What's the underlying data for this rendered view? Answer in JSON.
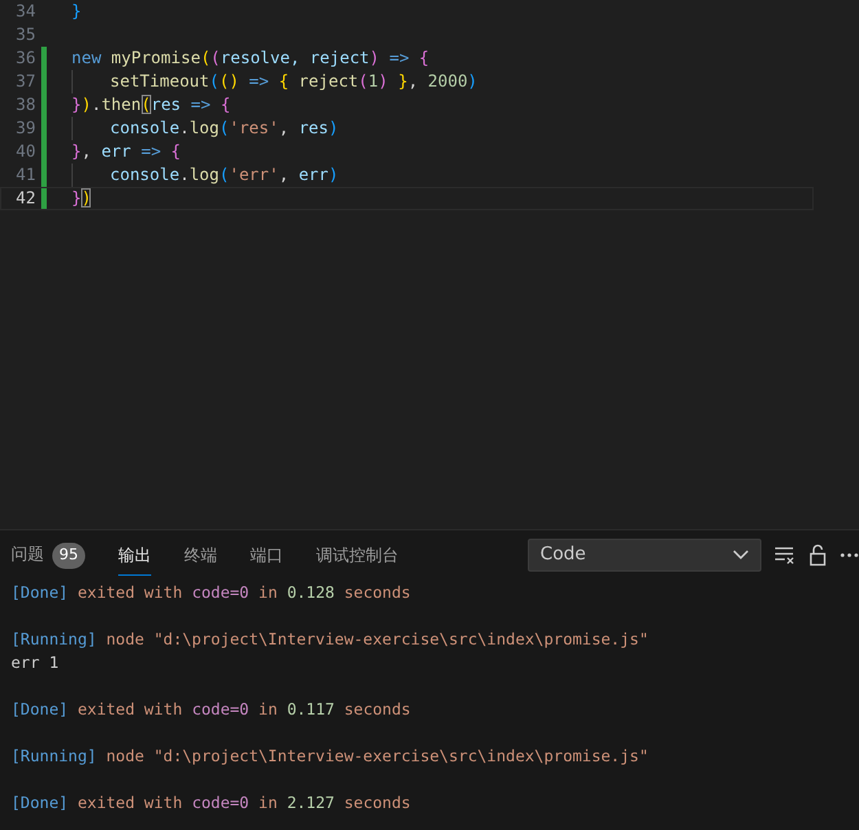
{
  "editor": {
    "lines": [
      {
        "number": "34",
        "modified": false,
        "current": false,
        "tokens": [
          {
            "t": "}",
            "color": "#179fff"
          }
        ]
      },
      {
        "number": "35",
        "modified": false,
        "current": false
      },
      {
        "number": "36",
        "modified": true,
        "current": false,
        "tokens": [
          {
            "t": "new ",
            "color": "#569cd6"
          },
          {
            "t": "myPromise",
            "color": "#dcdcaa"
          },
          {
            "t": "(",
            "color": "#ffd700"
          },
          {
            "t": "(",
            "color": "#da70d6"
          },
          {
            "t": "resolve, reject",
            "color": "#9cdcfe"
          },
          {
            "t": ")",
            "color": "#da70d6"
          },
          {
            "t": " => ",
            "color": "#569cd6"
          },
          {
            "t": "{",
            "color": "#da70d6"
          }
        ],
        "children": [
          {
            "number": "37",
            "modified": true,
            "current": false,
            "tokens": [
              {
                "t": "setTimeout",
                "color": "#dcdcaa"
              },
              {
                "t": "(",
                "color": "#179fff"
              },
              {
                "t": "()",
                "color": "#ffd700"
              },
              {
                "t": " => ",
                "color": "#569cd6"
              },
              {
                "t": "{ ",
                "color": "#ffd700"
              },
              {
                "t": "reject",
                "color": "#dcdcaa"
              },
              {
                "t": "(",
                "color": "#da70d6"
              },
              {
                "t": "1",
                "color": "#b5cea8"
              },
              {
                "t": ")",
                "color": "#da70d6"
              },
              {
                "t": " }",
                "color": "#ffd700"
              },
              {
                "t": ", ",
                "color": "#d4d4d4"
              },
              {
                "t": "2000",
                "color": "#b5cea8"
              },
              {
                "t": ")",
                "color": "#179fff"
              }
            ]
          }
        ]
      },
      {
        "number": "38",
        "modified": true,
        "current": false,
        "tokens": [
          {
            "t": "}",
            "color": "#da70d6"
          },
          {
            "t": ")",
            "color": "#ffd700"
          },
          {
            "t": ".",
            "color": "#d4d4d4"
          },
          {
            "t": "then",
            "color": "#dcdcaa"
          },
          {
            "t": "(",
            "color": "#ffd700",
            "boxed": true
          },
          {
            "t": "res",
            "color": "#9cdcfe"
          },
          {
            "t": " => ",
            "color": "#569cd6"
          },
          {
            "t": "{",
            "color": "#da70d6"
          }
        ],
        "children": [
          {
            "number": "39",
            "modified": true,
            "current": false,
            "tokens": [
              {
                "t": "console",
                "color": "#9cdcfe"
              },
              {
                "t": ".",
                "color": "#d4d4d4"
              },
              {
                "t": "log",
                "color": "#dcdcaa"
              },
              {
                "t": "(",
                "color": "#179fff"
              },
              {
                "t": "'res'",
                "color": "#ce9178"
              },
              {
                "t": ", ",
                "color": "#d4d4d4"
              },
              {
                "t": "res",
                "color": "#9cdcfe"
              },
              {
                "t": ")",
                "color": "#179fff"
              }
            ]
          }
        ]
      },
      {
        "number": "40",
        "modified": true,
        "current": false,
        "tokens": [
          {
            "t": "}",
            "color": "#da70d6"
          },
          {
            "t": ", ",
            "color": "#d4d4d4"
          },
          {
            "t": "err",
            "color": "#9cdcfe"
          },
          {
            "t": " => ",
            "color": "#569cd6"
          },
          {
            "t": "{",
            "color": "#da70d6"
          }
        ],
        "children": [
          {
            "number": "41",
            "modified": true,
            "current": false,
            "tokens": [
              {
                "t": "console",
                "color": "#9cdcfe"
              },
              {
                "t": ".",
                "color": "#d4d4d4"
              },
              {
                "t": "log",
                "color": "#dcdcaa"
              },
              {
                "t": "(",
                "color": "#179fff"
              },
              {
                "t": "'err'",
                "color": "#ce9178"
              },
              {
                "t": ", ",
                "color": "#d4d4d4"
              },
              {
                "t": "err",
                "color": "#9cdcfe"
              },
              {
                "t": ")",
                "color": "#179fff"
              }
            ]
          }
        ]
      },
      {
        "number": "42",
        "modified": true,
        "current": true,
        "tokens": [
          {
            "t": "}",
            "color": "#da70d6"
          },
          {
            "t": ")",
            "color": "#ffd700",
            "boxed": true
          }
        ]
      }
    ]
  },
  "panel": {
    "tabs": [
      {
        "label": "问题",
        "badge": "95",
        "selected": false
      },
      {
        "label": "输出",
        "selected": true
      },
      {
        "label": "终端",
        "selected": false
      },
      {
        "label": "端口",
        "selected": false
      },
      {
        "label": "调试控制台",
        "selected": false
      }
    ],
    "dropdown": {
      "value": "Code"
    },
    "output": [
      {
        "lines": [
          {
            "tokens": [
              {
                "t": "[Done]",
                "color": "#569cd6"
              },
              {
                "t": " exited with ",
                "color": "#ce9178"
              },
              {
                "t": "code=0",
                "color": "#c586c0"
              },
              {
                "t": " in ",
                "color": "#ce9178"
              },
              {
                "t": "0.128",
                "color": "#b5cea8"
              },
              {
                "t": " seconds",
                "color": "#ce9178"
              }
            ]
          }
        ]
      },
      {
        "lines": [
          {
            "tokens": [
              {
                "t": "[Running]",
                "color": "#569cd6"
              },
              {
                "t": " node \"d:\\project\\Interview-exercise\\src\\index\\promise.js\"",
                "color": "#ce9178"
              }
            ]
          },
          {
            "tokens": [
              {
                "t": "err 1",
                "color": "#cccccc"
              }
            ]
          }
        ]
      },
      {
        "lines": [
          {
            "tokens": [
              {
                "t": "[Done]",
                "color": "#569cd6"
              },
              {
                "t": " exited with ",
                "color": "#ce9178"
              },
              {
                "t": "code=0",
                "color": "#c586c0"
              },
              {
                "t": " in ",
                "color": "#ce9178"
              },
              {
                "t": "0.117",
                "color": "#b5cea8"
              },
              {
                "t": " seconds",
                "color": "#ce9178"
              }
            ]
          }
        ]
      },
      {
        "lines": [
          {
            "tokens": [
              {
                "t": "[Running]",
                "color": "#569cd6"
              },
              {
                "t": " node \"d:\\project\\Interview-exercise\\src\\index\\promise.js\"",
                "color": "#ce9178"
              }
            ]
          }
        ]
      },
      {
        "lines": [
          {
            "tokens": [
              {
                "t": "[Done]",
                "color": "#569cd6"
              },
              {
                "t": " exited with ",
                "color": "#ce9178"
              },
              {
                "t": "code=0",
                "color": "#c586c0"
              },
              {
                "t": " in ",
                "color": "#ce9178"
              },
              {
                "t": "2.127",
                "color": "#b5cea8"
              },
              {
                "t": " seconds",
                "color": "#ce9178"
              }
            ]
          }
        ]
      }
    ]
  }
}
